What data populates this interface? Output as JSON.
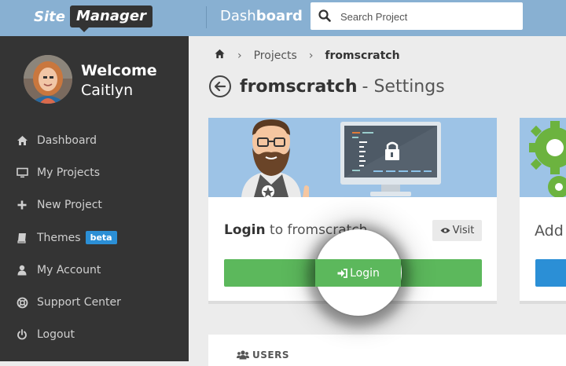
{
  "header": {
    "logo_site": "Site",
    "logo_manager": "Manager",
    "section_light": "Dash",
    "section_bold": "board",
    "search_placeholder": "Search Project"
  },
  "user": {
    "welcome": "Welcome",
    "name": "Caitlyn"
  },
  "sidebar": {
    "items": [
      {
        "label": "Dashboard",
        "icon": "home-icon"
      },
      {
        "label": "My Projects",
        "icon": "monitor-icon"
      },
      {
        "label": "New Project",
        "icon": "plus-icon"
      },
      {
        "label": "Themes",
        "icon": "book-icon",
        "badge": "beta"
      },
      {
        "label": "My Account",
        "icon": "user-icon"
      },
      {
        "label": "Support Center",
        "icon": "lifebuoy-icon"
      },
      {
        "label": "Logout",
        "icon": "power-icon"
      }
    ]
  },
  "breadcrumb": {
    "home_icon": "home-icon",
    "items": [
      "Projects",
      "fromscratch"
    ]
  },
  "page": {
    "project": "fromscratch",
    "title_suffix": "- Settings"
  },
  "login_card": {
    "label_bold": "Login",
    "label_rest": "to fromscratch",
    "visit_label": "Visit",
    "login_button": "Login"
  },
  "second_card": {
    "label": "Add p"
  },
  "users_section": {
    "label": "USERS"
  },
  "colors": {
    "topbar": "#88b0d2",
    "sidebar": "#343434",
    "green": "#5cb85c",
    "blue": "#2b8fd6"
  }
}
